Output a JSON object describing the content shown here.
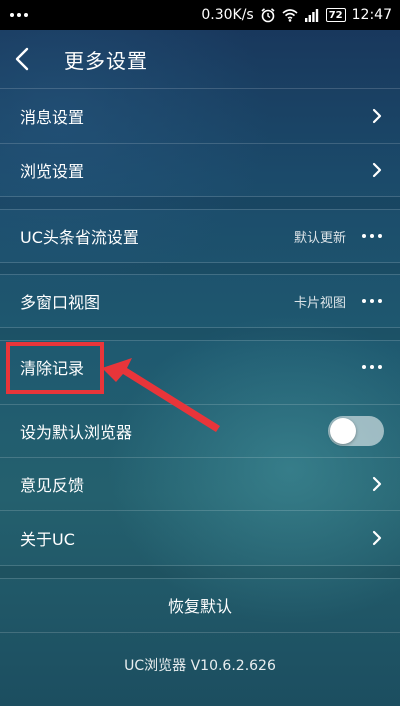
{
  "status_bar": {
    "speed": "0.30K/s",
    "battery": "72",
    "time": "12:47"
  },
  "header": {
    "title": "更多设置"
  },
  "settings": {
    "message": {
      "label": "消息设置"
    },
    "browse": {
      "label": "浏览设置"
    },
    "uc_headline": {
      "label": "UC头条省流设置",
      "value": "默认更新"
    },
    "multi_window": {
      "label": "多窗口视图",
      "value": "卡片视图"
    },
    "clear_history": {
      "label": "清除记录"
    },
    "default_browser": {
      "label": "设为默认浏览器",
      "enabled": false
    },
    "feedback": {
      "label": "意见反馈"
    },
    "about": {
      "label": "关于UC"
    }
  },
  "restore_default": "恢复默认",
  "version": "UC浏览器 V10.6.2.626",
  "colors": {
    "annotation": "#e8353a",
    "status_bar_bg": "#000000"
  }
}
